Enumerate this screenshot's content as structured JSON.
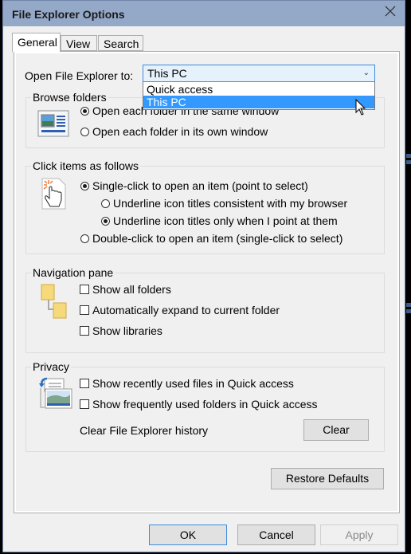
{
  "window": {
    "title": "File Explorer Options",
    "close_icon": "close-icon"
  },
  "tabs": [
    {
      "label": "General",
      "active": true
    },
    {
      "label": "View",
      "active": false
    },
    {
      "label": "Search",
      "active": false
    }
  ],
  "open_to": {
    "label": "Open File Explorer to:",
    "value": "This PC",
    "options": [
      {
        "label": "Quick access",
        "selected": false
      },
      {
        "label": "This PC",
        "selected": true
      }
    ]
  },
  "browse_folders": {
    "title": "Browse folders",
    "icon": "window-icon",
    "options": [
      {
        "label": "Open each folder in the same window",
        "checked": true
      },
      {
        "label": "Open each folder in its own window",
        "checked": false
      }
    ]
  },
  "click_items": {
    "title": "Click items as follows",
    "icon": "pointer-hand-icon",
    "single_click": {
      "label": "Single-click to open an item (point to select)",
      "checked": true
    },
    "underline_browser": {
      "label": "Underline icon titles consistent with my browser",
      "checked": false
    },
    "underline_point": {
      "label": "Underline icon titles only when I point at them",
      "checked": true
    },
    "double_click": {
      "label": "Double-click to open an item (single-click to select)",
      "checked": false
    }
  },
  "navigation_pane": {
    "title": "Navigation pane",
    "icon": "folder-tree-icon",
    "options": [
      {
        "label": "Show all folders",
        "checked": false
      },
      {
        "label": "Automatically expand to current folder",
        "checked": false
      },
      {
        "label": "Show libraries",
        "checked": false
      }
    ]
  },
  "privacy": {
    "title": "Privacy",
    "icon": "history-icon",
    "options": [
      {
        "label": "Show recently used files in Quick access",
        "checked": false
      },
      {
        "label": "Show frequently used folders in Quick access",
        "checked": false
      }
    ],
    "clear_label": "Clear File Explorer history",
    "clear_button": "Clear"
  },
  "restore_defaults": "Restore Defaults",
  "footer": {
    "ok": "OK",
    "cancel": "Cancel",
    "apply": "Apply"
  }
}
